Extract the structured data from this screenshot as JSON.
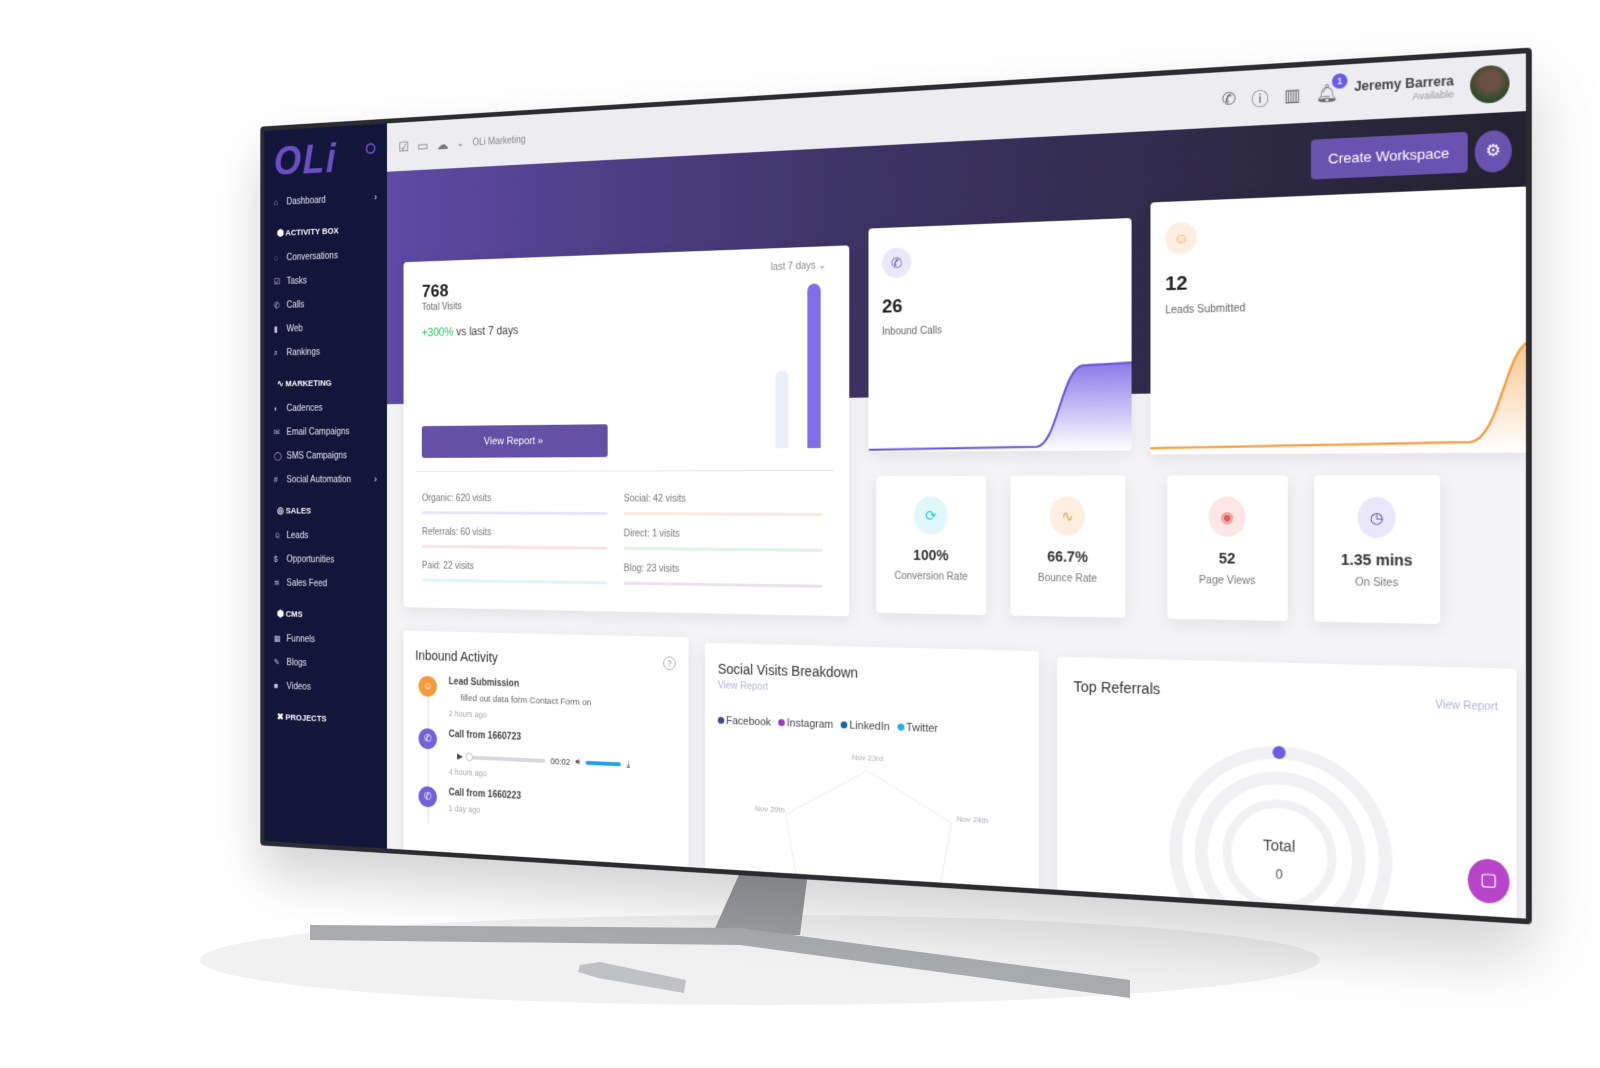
{
  "sidebar": {
    "logo": "OLi",
    "dashboard": "Dashboard",
    "sections": [
      {
        "title": "ACTIVITY BOX",
        "items": [
          "Conversations",
          "Tasks",
          "Calls",
          "Web",
          "Rankings"
        ]
      },
      {
        "title": "MARKETING",
        "items": [
          "Cadences",
          "Email Campaigns",
          "SMS Campaigns",
          "Social Automation"
        ]
      },
      {
        "title": "SALES",
        "items": [
          "Leads",
          "Opportunities",
          "Sales Feed"
        ]
      },
      {
        "title": "CMS",
        "items": [
          "Funnels",
          "Blogs",
          "Videos"
        ]
      },
      {
        "title": "PROJECTS",
        "items": []
      }
    ]
  },
  "topbar": {
    "breadcrumb": "OLi Marketing",
    "notification_count": "1",
    "user_name": "Jeremy Barrera",
    "user_status": "Available"
  },
  "header": {
    "create_workspace": "Create Workspace"
  },
  "visits": {
    "total": "768",
    "label": "Total Visits",
    "growth": "+300%",
    "growth_suffix": "vs last 7 days",
    "range": "last 7 days",
    "view_report": "View Report »",
    "bars": [
      0.47,
      1.0
    ],
    "sources": [
      {
        "label": "Organic: 620 visits",
        "color": "#e6e3fb"
      },
      {
        "label": "Social:  42 visits",
        "color": "#fde7d9"
      },
      {
        "label": "Referrals:  60 visits",
        "color": "#fbe0e0"
      },
      {
        "label": "Direct: 1 visits",
        "color": "#dcf3e4"
      },
      {
        "label": "Paid:  22 visits",
        "color": "#dcf4fa"
      },
      {
        "label": "Blog:  23 visits",
        "color": "#ecdff0"
      }
    ]
  },
  "inbound_calls": {
    "value": "26",
    "label": "Inbound Calls"
  },
  "leads": {
    "value": "12",
    "label": "Leads Submitted"
  },
  "stats": [
    {
      "value": "100%",
      "label": "Conversion Rate",
      "icon": "refresh-icon",
      "color": "#1fc6e0",
      "bg": "#dff7fb"
    },
    {
      "value": "66.7%",
      "label": "Bounce Rate",
      "icon": "activity-icon",
      "color": "#f59a3c",
      "bg": "#fdeee0"
    },
    {
      "value": "52",
      "label": "Page Views",
      "icon": "eye-icon",
      "color": "#ea5a5a",
      "bg": "#fce6e6"
    },
    {
      "value": "1.35 mins",
      "label": "On Sites",
      "icon": "clock-icon",
      "color": "#5b4aa8",
      "bg": "#ebe7fb"
    }
  ],
  "inbound_activity": {
    "title": "Inbound Activity",
    "events": [
      {
        "title": "Lead Submission",
        "detail": "filled out data form Contact Form on",
        "ago": "2 hours ago"
      },
      {
        "title": "Call from 1660723",
        "time": "00:02",
        "ago": "4 hours ago"
      },
      {
        "title": "Call from 1660223",
        "ago": "1 day ago"
      }
    ]
  },
  "social": {
    "title": "Social Visits Breakdown",
    "view_report": "View Report",
    "legend": [
      {
        "name": "Facebook",
        "color": "#3b4a9c"
      },
      {
        "name": "Instagram",
        "color": "#9b35c4"
      },
      {
        "name": "LinkedIn",
        "color": "#1565b0"
      },
      {
        "name": "Twitter",
        "color": "#1fb0f0"
      }
    ],
    "axes": [
      "Nov 23rd",
      "Nov 24th",
      "Nov 29th"
    ]
  },
  "referrals": {
    "title": "Top Referrals",
    "view_report": "View Report",
    "total_label": "Total",
    "total": "0"
  }
}
